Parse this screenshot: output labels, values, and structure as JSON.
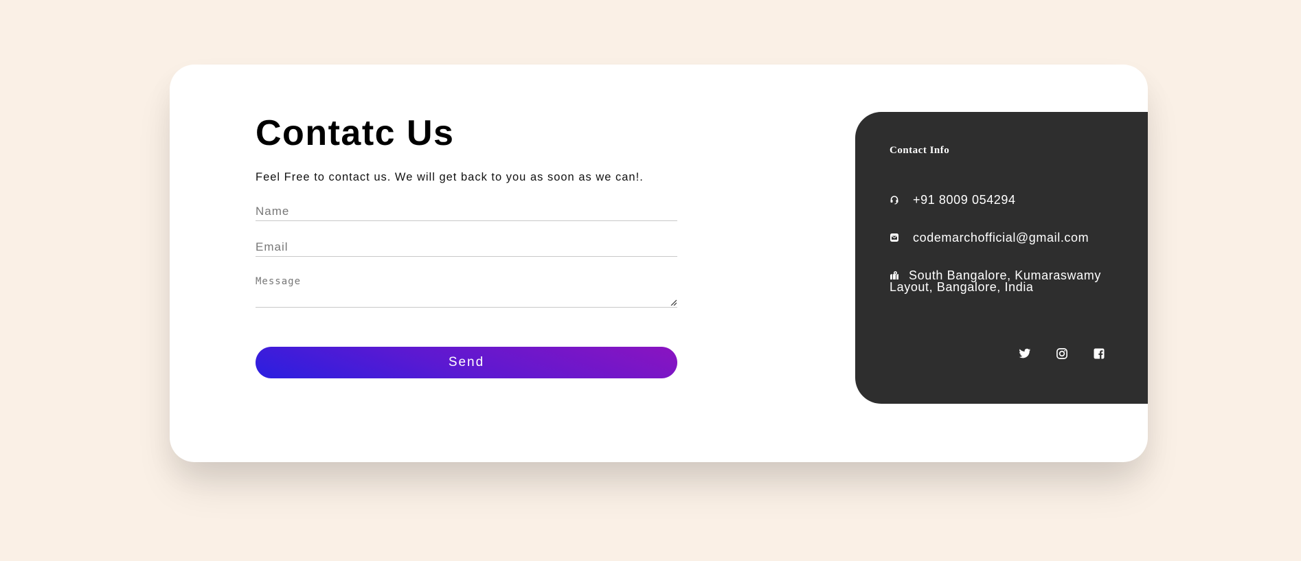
{
  "page": {
    "background": "#faf0e6"
  },
  "form": {
    "title": "Contatc Us",
    "subtitle": "Feel Free to contact us. We will get back to you as soon as we can!.",
    "name_placeholder": "Name",
    "email_placeholder": "Email",
    "message_placeholder": "Message",
    "send_label": "Send",
    "button_gradient": [
      "#2a1fe0",
      "#8a14c0"
    ]
  },
  "info": {
    "title": "Contact Info",
    "phone": "+91 8009 054294",
    "email": "codemarchofficial@gmail.com",
    "address": "South Bangalore, Kumaraswamy Layout, Bangalore, India",
    "panel_color": "#2e2e2e",
    "items": [
      {
        "icon": "headset-icon",
        "field": "phone"
      },
      {
        "icon": "envelope-icon",
        "field": "email"
      },
      {
        "icon": "map-marker-icon",
        "field": "address"
      }
    ],
    "socials": [
      {
        "icon": "twitter-icon"
      },
      {
        "icon": "instagram-icon"
      },
      {
        "icon": "facebook-icon"
      }
    ]
  }
}
